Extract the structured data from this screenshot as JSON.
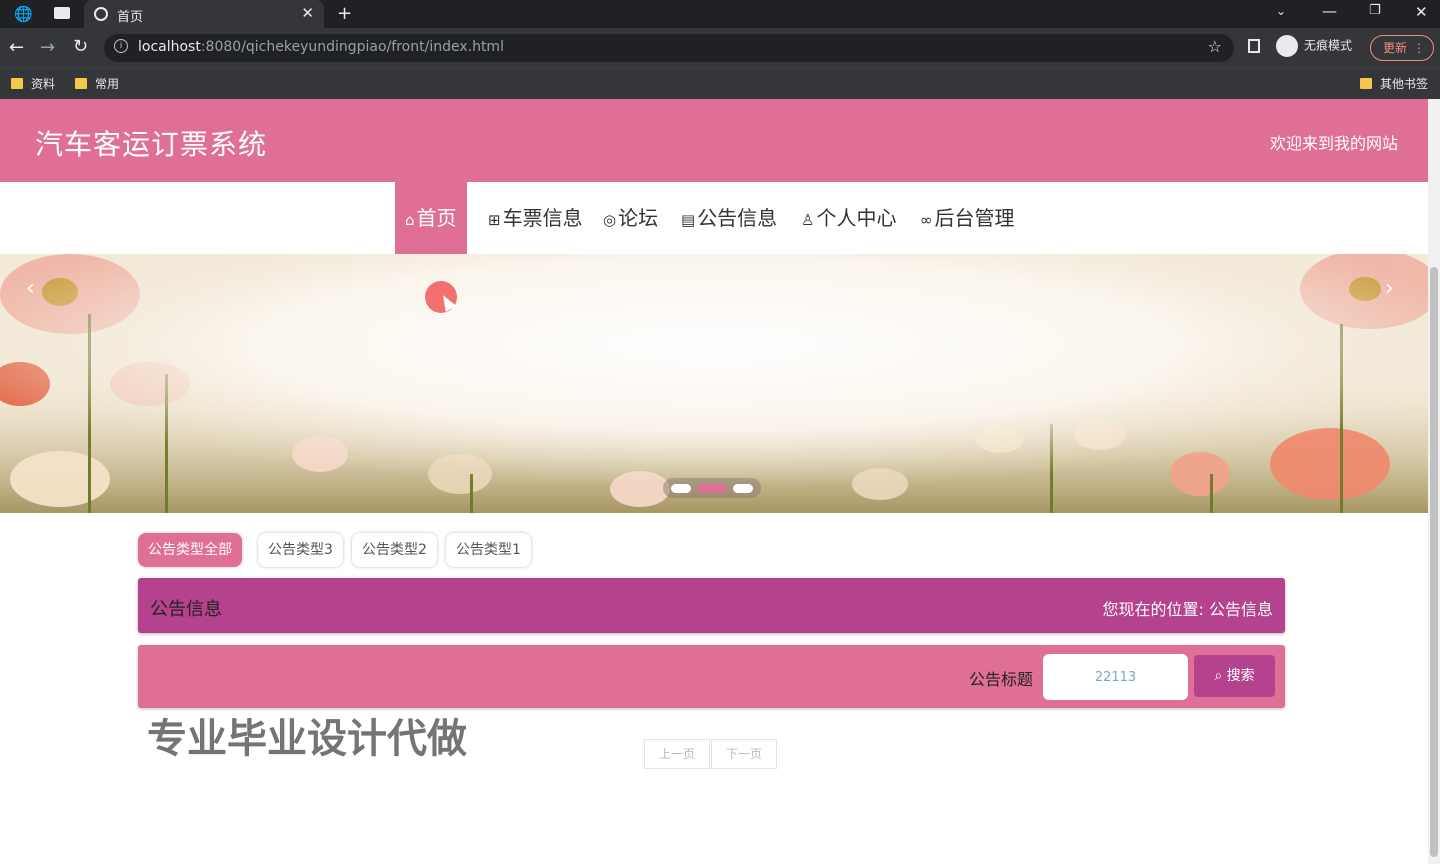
{
  "browser": {
    "tab_title": "首页",
    "url_host": "localhost",
    "url_rest": ":8080/qichekeyundingpiao/front/index.html",
    "incognito_label": "无痕模式",
    "update_label": "更新",
    "bookmarks": [
      "资料",
      "常用"
    ],
    "other_bookmarks": "其他书签"
  },
  "site": {
    "title": "汽车客运订票系统",
    "welcome": "欢迎来到我的网站",
    "nav": [
      {
        "label": "首页",
        "icon": "home-icon"
      },
      {
        "label": "车票信息",
        "icon": "grid-icon"
      },
      {
        "label": "论坛",
        "icon": "palette-icon"
      },
      {
        "label": "公告信息",
        "icon": "clipboard-icon"
      },
      {
        "label": "个人中心",
        "icon": "user-icon"
      },
      {
        "label": "后台管理",
        "icon": "link-icon"
      }
    ],
    "banner_active_dot": 2
  },
  "filters": [
    "公告类型全部",
    "公告类型3",
    "公告类型2",
    "公告类型1"
  ],
  "section": {
    "title": "公告信息",
    "crumb": "您现在的位置: 公告信息"
  },
  "search": {
    "label": "公告标题",
    "value": "22113",
    "button": "搜索"
  },
  "watermark": "专业毕业设计代做",
  "pager": {
    "prev": "上一页",
    "next": "下一页"
  },
  "colors": {
    "primary": "#e06f97",
    "accent": "#b4428f"
  }
}
